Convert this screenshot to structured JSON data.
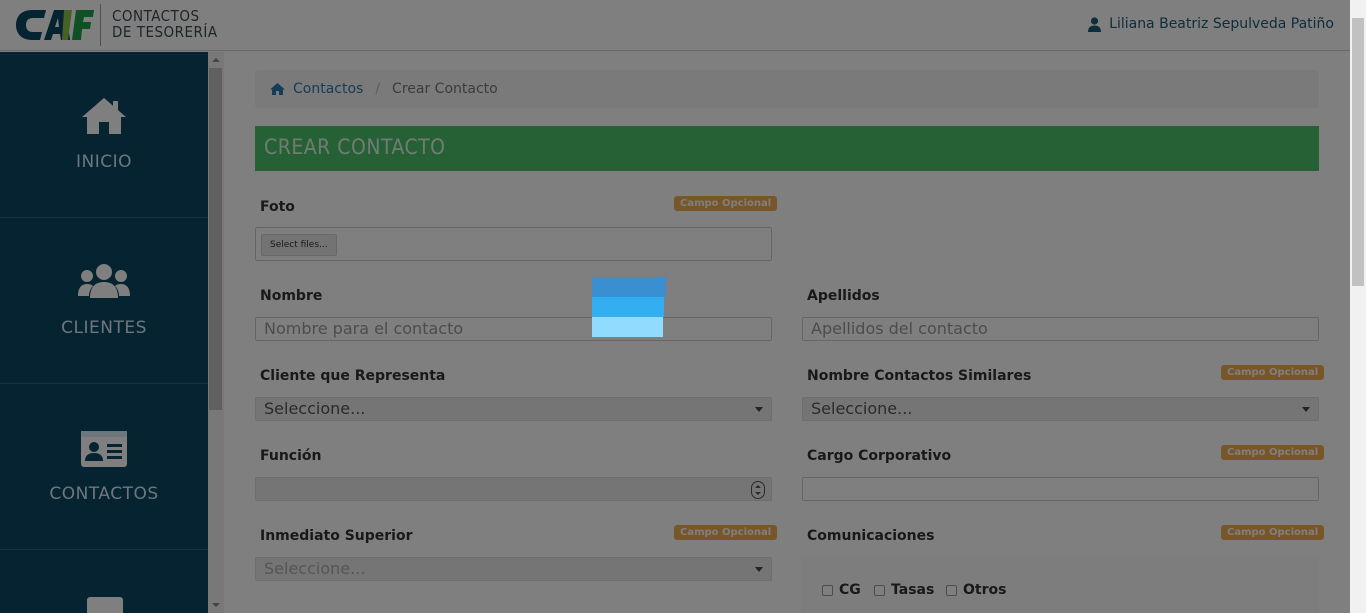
{
  "header": {
    "brand_line1": "CONTACTOS",
    "brand_line2": "DE TESORERÍA",
    "logo_text": "CAF",
    "user_name": "Liliana Beatriz Sepulveda Patiño"
  },
  "sidebar": {
    "items": [
      {
        "label": "INICIO",
        "icon": "home-icon"
      },
      {
        "label": "CLIENTES",
        "icon": "users-icon"
      },
      {
        "label": "CONTACTOS",
        "icon": "contact-card-icon"
      }
    ]
  },
  "breadcrumb": {
    "home_label": "Contactos",
    "current_label": "Crear Contacto"
  },
  "page_title": "CREAR CONTACTO",
  "optional_badge": "Campo Opcional",
  "form": {
    "foto": {
      "label": "Foto",
      "button": "Select files..."
    },
    "nombre": {
      "label": "Nombre",
      "placeholder": "Nombre para el contacto"
    },
    "apellidos": {
      "label": "Apellidos",
      "placeholder": "Apellidos del contacto"
    },
    "cliente": {
      "label": "Cliente que Representa",
      "value": "Seleccione..."
    },
    "similares": {
      "label": "Nombre Contactos Similares",
      "value": "Seleccione..."
    },
    "funcion": {
      "label": "Función"
    },
    "cargo": {
      "label": "Cargo Corporativo"
    },
    "superior": {
      "label": "Inmediato Superior",
      "value": "Seleccione..."
    },
    "comunicaciones": {
      "label": "Comunicaciones",
      "options": [
        "CG",
        "Tasas",
        "Otros"
      ]
    }
  },
  "colors": {
    "sidebar_bg": "#0b4660",
    "title_bar": "#4cc36c",
    "badge": "#f0ad4e",
    "link": "#2a7ab0",
    "loader": [
      "#3a8fd1",
      "#33aef0",
      "#8fdcff"
    ]
  }
}
